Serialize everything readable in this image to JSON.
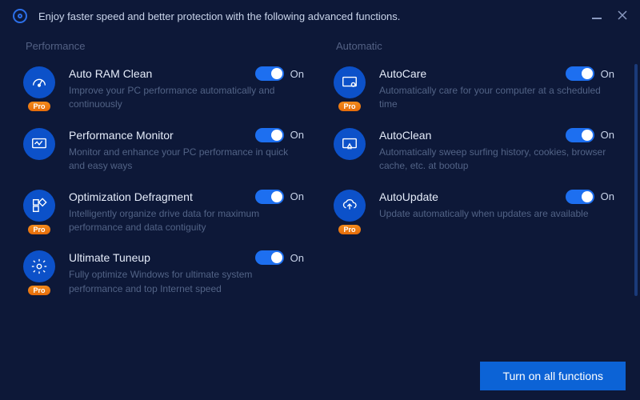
{
  "header": {
    "title": "Enjoy faster speed and better protection with the following advanced functions."
  },
  "sections": {
    "left_title": "Performance",
    "right_title": "Automatic"
  },
  "toggle": {
    "on_label": "On"
  },
  "pro_label": "Pro",
  "features": {
    "auto_ram": {
      "title": "Auto RAM Clean",
      "desc": "Improve your PC performance automatically and continuously",
      "pro": true
    },
    "perf_monitor": {
      "title": "Performance Monitor",
      "desc": "Monitor and enhance your PC performance in quick and easy ways",
      "pro": false
    },
    "opt_defrag": {
      "title": "Optimization Defragment",
      "desc": "Intelligently organize drive data for maximum performance and data contiguity",
      "pro": true
    },
    "ultimate_tuneup": {
      "title": "Ultimate Tuneup",
      "desc": "Fully optimize Windows for ultimate system performance and top Internet speed",
      "pro": true
    },
    "autocare": {
      "title": "AutoCare",
      "desc": "Automatically care for your computer at a scheduled time",
      "pro": true
    },
    "autoclean": {
      "title": "AutoClean",
      "desc": "Automatically sweep surfing history, cookies, browser cache, etc. at bootup",
      "pro": false
    },
    "autoupdate": {
      "title": "AutoUpdate",
      "desc": "Update automatically when updates are available",
      "pro": true
    }
  },
  "footer": {
    "primary_button": "Turn on all functions"
  }
}
